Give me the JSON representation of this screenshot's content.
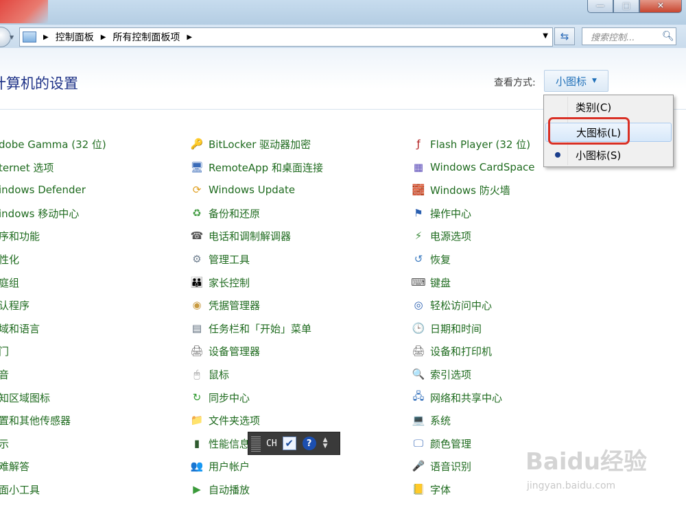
{
  "window": {
    "minimize_glyph": "—",
    "maximize_glyph": "□",
    "close_glyph": "✕"
  },
  "address_bar": {
    "crumbs": [
      "控制面板",
      "所有控制面板项"
    ],
    "search_placeholder": "搜索控制..."
  },
  "page": {
    "title": "计算机的设置",
    "view_label": "查看方式:",
    "view_value": "小图标"
  },
  "view_menu": {
    "items": [
      {
        "label": "类别(C)",
        "selected": false
      },
      {
        "label": "大图标(L)",
        "selected": false,
        "highlighted": true
      },
      {
        "label": "小图标(S)",
        "selected": true
      }
    ]
  },
  "columns": {
    "col1": [
      {
        "label": "dobe Gamma (32 位)"
      },
      {
        "label": "ternet 选项"
      },
      {
        "label": "indows Defender"
      },
      {
        "label": "indows 移动中心"
      },
      {
        "label": "序和功能"
      },
      {
        "label": "性化"
      },
      {
        "label": "庭组"
      },
      {
        "label": "认程序"
      },
      {
        "label": "域和语言"
      },
      {
        "label": "门"
      },
      {
        "label": "音"
      },
      {
        "label": "知区域图标"
      },
      {
        "label": "置和其他传感器"
      },
      {
        "label": "示"
      },
      {
        "label": "难解答"
      },
      {
        "label": "面小工具"
      }
    ],
    "col2": [
      {
        "label": "BitLocker 驱动器加密",
        "icon": "bitlocker-icon",
        "glyph": "🔑",
        "color": "#c8a03a"
      },
      {
        "label": "RemoteApp 和桌面连接",
        "icon": "remoteapp-icon",
        "glyph": "🖥",
        "color": "#3a6bb8"
      },
      {
        "label": "Windows Update",
        "icon": "windows-update-icon",
        "glyph": "⟳",
        "color": "#e0a020"
      },
      {
        "label": "备份和还原",
        "icon": "backup-icon",
        "glyph": "♻",
        "color": "#3f9a3f"
      },
      {
        "label": "电话和调制解调器",
        "icon": "phone-modem-icon",
        "glyph": "☎",
        "color": "#555555"
      },
      {
        "label": "管理工具",
        "icon": "admin-tools-icon",
        "glyph": "⚙",
        "color": "#6f7f8f"
      },
      {
        "label": "家长控制",
        "icon": "parental-controls-icon",
        "glyph": "👪",
        "color": "#3a78c8"
      },
      {
        "label": "凭据管理器",
        "icon": "credential-manager-icon",
        "glyph": "◉",
        "color": "#c89a40"
      },
      {
        "label": "任务栏和「开始」菜单",
        "icon": "taskbar-icon",
        "glyph": "▤",
        "color": "#5a6a7a"
      },
      {
        "label": "设备管理器",
        "icon": "device-manager-icon",
        "glyph": "🖨",
        "color": "#6a6a6a"
      },
      {
        "label": "鼠标",
        "icon": "mouse-icon",
        "glyph": "🖱",
        "color": "#888888"
      },
      {
        "label": "同步中心",
        "icon": "sync-center-icon",
        "glyph": "↻",
        "color": "#2f9a2f"
      },
      {
        "label": "文件夹选项",
        "icon": "folder-options-icon",
        "glyph": "📁",
        "color": "#d9a52a"
      },
      {
        "label": "性能信息",
        "icon": "performance-icon",
        "glyph": "▮",
        "color": "#2e5a2e"
      },
      {
        "label": "用户帐户",
        "icon": "user-accounts-icon",
        "glyph": "👥",
        "color": "#3a7ac0"
      },
      {
        "label": "自动播放",
        "icon": "autoplay-icon",
        "glyph": "▶",
        "color": "#3a9a3a"
      }
    ],
    "col3": [
      {
        "label": "Flash Player (32 位)",
        "icon": "flash-player-icon",
        "glyph": "ƒ",
        "color": "#b01c1c"
      },
      {
        "label": "Windows CardSpace",
        "icon": "cardspace-icon",
        "glyph": "▦",
        "color": "#5a4ab8"
      },
      {
        "label": "Windows 防火墙",
        "icon": "firewall-icon",
        "glyph": "🧱",
        "color": "#b8502a"
      },
      {
        "label": "操作中心",
        "icon": "action-center-icon",
        "glyph": "⚑",
        "color": "#2a5fb0"
      },
      {
        "label": "电源选项",
        "icon": "power-options-icon",
        "glyph": "⚡",
        "color": "#3a8a3a"
      },
      {
        "label": "恢复",
        "icon": "recovery-icon",
        "glyph": "↺",
        "color": "#3a7ac0"
      },
      {
        "label": "键盘",
        "icon": "keyboard-icon",
        "glyph": "⌨",
        "color": "#555555"
      },
      {
        "label": "轻松访问中心",
        "icon": "ease-of-access-icon",
        "glyph": "◎",
        "color": "#2a5fb0"
      },
      {
        "label": "日期和时间",
        "icon": "date-time-icon",
        "glyph": "🕒",
        "color": "#6a7a8a"
      },
      {
        "label": "设备和打印机",
        "icon": "devices-printers-icon",
        "glyph": "🖨",
        "color": "#6a6a6a"
      },
      {
        "label": "索引选项",
        "icon": "indexing-icon",
        "glyph": "🔍",
        "color": "#6a7a8a"
      },
      {
        "label": "网络和共享中心",
        "icon": "network-center-icon",
        "glyph": "🖧",
        "color": "#2a6ab8"
      },
      {
        "label": "系统",
        "icon": "system-icon",
        "glyph": "💻",
        "color": "#3a6ab8"
      },
      {
        "label": "颜色管理",
        "icon": "color-management-icon",
        "glyph": "🖵",
        "color": "#3a6ab8"
      },
      {
        "label": "语音识别",
        "icon": "speech-recognition-icon",
        "glyph": "🎤",
        "color": "#7a7a7a"
      },
      {
        "label": "字体",
        "icon": "fonts-icon",
        "glyph": "📒",
        "color": "#d9a52a"
      }
    ]
  },
  "language_bar": {
    "lang": "CH",
    "help": "?"
  },
  "watermark": {
    "brand": "Bai",
    "logo_text": "du经验",
    "url": "jingyan.baidu.com"
  }
}
